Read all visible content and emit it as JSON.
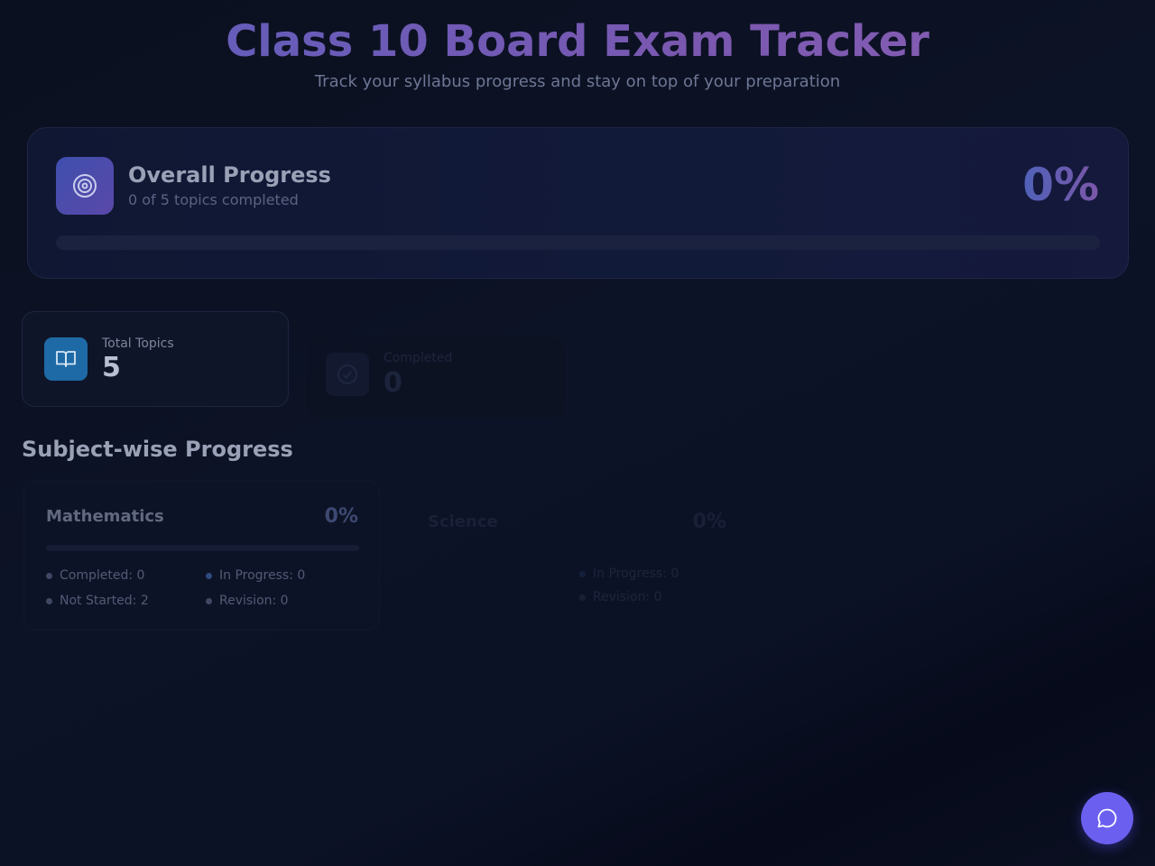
{
  "header": {
    "title": "Class 10 Board Exam Tracker",
    "subtitle": "Track your syllabus progress and stay on top of your preparation"
  },
  "overall": {
    "title": "Overall Progress",
    "summary": "0 of 5 topics completed",
    "percent_label": "0%",
    "progress_fraction": 0,
    "icon": "target-icon"
  },
  "stats": [
    {
      "label": "Total Topics",
      "value": "5",
      "icon": "book-icon"
    },
    {
      "label": "Completed",
      "value": "0",
      "icon": "check-circle-icon"
    }
  ],
  "subjects_section": {
    "title": "Subject-wise Progress",
    "subjects": [
      {
        "name": "Mathematics",
        "percent_label": "0%",
        "progress_fraction": 0,
        "legend": [
          {
            "label": "Completed: 0",
            "color": "#4f5a78"
          },
          {
            "label": "In Progress: 0",
            "color": "#3b5c9a"
          },
          {
            "label": "Not Started: 2",
            "color": "#4f5a78"
          },
          {
            "label": "Revision: 0",
            "color": "#4f5a78"
          }
        ]
      },
      {
        "name": "Science",
        "percent_label": "0%",
        "progress_fraction": 0,
        "legend": [
          {
            "label": "",
            "color": "#4f5a78"
          },
          {
            "label": "In Progress: 0",
            "color": "#3b5c9a"
          },
          {
            "label": "",
            "color": "#4f5a78"
          },
          {
            "label": "Revision: 0",
            "color": "#4f5a78"
          }
        ]
      }
    ]
  },
  "colors": {
    "accent": "#6b5ff0",
    "title_gradient_start": "#5c5fbf",
    "title_gradient_end": "#8a5fb4",
    "info_blue": "#1e6aa6"
  },
  "chat_button": {
    "icon": "chat-bubble-icon"
  }
}
